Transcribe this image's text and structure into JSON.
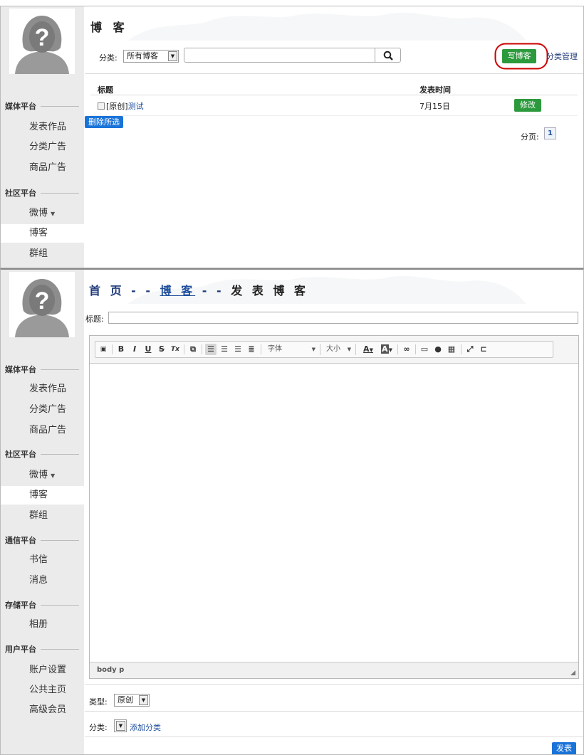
{
  "sidebar_top": {
    "sections": [
      {
        "head": "媒体平台",
        "items": [
          "发表作品",
          "分类广告",
          "商品广告"
        ]
      },
      {
        "head": "社区平台",
        "items": [
          "微博",
          "博客",
          "群组"
        ]
      }
    ]
  },
  "sidebar_bottom": {
    "sections": [
      {
        "head": "媒体平台",
        "items": [
          "发表作品",
          "分类广告",
          "商品广告"
        ]
      },
      {
        "head": "社区平台",
        "items": [
          "微博",
          "博客",
          "群组"
        ]
      },
      {
        "head": "通信平台",
        "items": [
          "书信",
          "消息"
        ]
      },
      {
        "head": "存储平台",
        "items": [
          "相册"
        ]
      },
      {
        "head": "用户平台",
        "items": [
          "账户设置",
          "公共主页",
          "高级会员"
        ]
      }
    ]
  },
  "blog_list": {
    "title": "博 客",
    "category_label": "分类:",
    "category_value": "所有博客",
    "search_value": "",
    "write_button": "写博客",
    "manage_link": "分类管理",
    "col_title": "标题",
    "col_time": "发表时间",
    "rows": [
      {
        "tag": "[原创]",
        "title": "测试",
        "time": "7月15日",
        "action": "修改"
      }
    ],
    "delete_button": "删除所选",
    "page_label": "分页:",
    "page_current": "1"
  },
  "compose": {
    "crumb_home": "首 页",
    "crumb_sep1": "- -",
    "crumb_blog": "博 客",
    "crumb_sep2": "- -",
    "crumb_current": "发 表 博 客",
    "title_label": "标题:",
    "title_value": "",
    "toolbar": {
      "bold": "B",
      "italic": "I",
      "underline": "U",
      "strike": "S",
      "clear": "Tx",
      "font_combo": "字体",
      "size_combo": "大小",
      "text_color": "A",
      "bg_color": "A"
    },
    "status_path": "body  p",
    "type_label": "类型:",
    "type_value": "原创",
    "category_label": "分类:",
    "category_value": "",
    "add_category_link": "添加分类",
    "publish_button": "发表"
  },
  "colors": {
    "green": "#2c9a3c",
    "blue": "#1a73d9",
    "link": "#1f4e9c",
    "highlight": "#cc0000"
  }
}
